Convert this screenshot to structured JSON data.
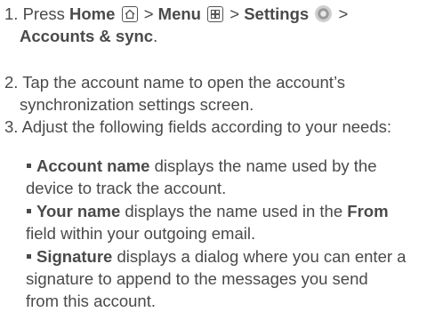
{
  "steps": [
    {
      "num": "1.",
      "t1": "Press ",
      "home": "Home",
      "gt1": " > ",
      "menu": "Menu",
      "gt2": " > ",
      "settings": "Settings",
      "gt3": " >",
      "accounts": "Accounts & sync",
      "end": "."
    },
    {
      "num": "2.",
      "line1": "Tap the account name to open the account’s",
      "line2": "synchronization settings screen."
    },
    {
      "num": "3.",
      "line1": "Adjust the following fields according to your needs:"
    }
  ],
  "bullets": [
    {
      "term": "Account name",
      "line1_rest": " displays the name used by the",
      "line2": "device to track the account."
    },
    {
      "term": "Your name",
      "line1_rest": " displays the name used in the ",
      "from": "From",
      "line2": "field within your outgoing email."
    },
    {
      "term": "Signature",
      "line1_rest": " displays a dialog where you can enter a",
      "line2": "signature to append to the messages you send",
      "line3": "from this account."
    }
  ],
  "icons": {
    "home": "home-icon",
    "menu": "menu-grid-icon",
    "settings": "settings-gear-icon"
  }
}
